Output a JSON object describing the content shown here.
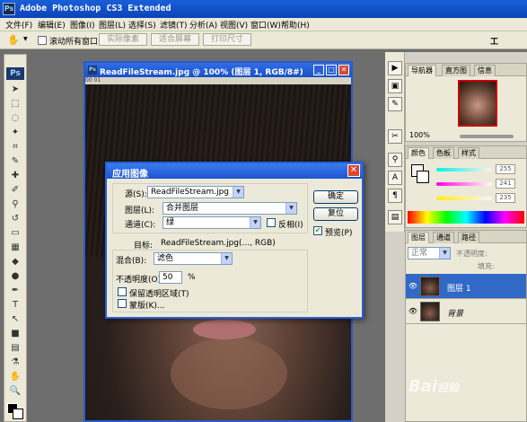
{
  "app": {
    "title": "Adobe Photoshop CS3 Extended",
    "logo": "Ps"
  },
  "menu": [
    "文件(F)",
    "编辑(E)",
    "图像(I)",
    "图层(L)",
    "选择(S)",
    "滤镜(T)",
    "分析(A)",
    "视图(V)",
    "窗口(W)",
    "帮助(H)"
  ],
  "options": {
    "scroll_all_windows": "滚动所有窗口",
    "actual_pixels": "实际像素",
    "fit_screen": "适合屏幕",
    "print_size": "打印尺寸",
    "workspace": "工"
  },
  "document": {
    "title": "ReadFileStream.jpg @ 100% (图层 1, RGB/8#)",
    "ruler_label": "00 01"
  },
  "panels": {
    "navigator_tabs": [
      "导航器",
      "直方图",
      "信息"
    ],
    "zoom": "100%",
    "color_tabs": [
      "颜色",
      "色板",
      "样式"
    ],
    "rgb": {
      "r": "255",
      "g": "241",
      "b": "235"
    },
    "layers_tabs": [
      "图层",
      "通道",
      "路径"
    ],
    "blend_mode": "正常",
    "opacity_label": "不透明度:",
    "fill_label": "填充:",
    "layers": [
      {
        "name": "图层 1",
        "selected": true
      },
      {
        "name": "背景",
        "selected": false
      }
    ]
  },
  "dialog": {
    "title": "应用图像",
    "source_label": "源(S):",
    "source_value": "ReadFileStream.jpg",
    "layer_label": "图层(L):",
    "layer_value": "合并图层",
    "channel_label": "通道(C):",
    "channel_value": "绿",
    "invert_label": "反相(I)",
    "target_label": "目标:",
    "target_value": "ReadFileStream.jpg(..., RGB)",
    "blending_label": "混合(B):",
    "blending_value": "滤色",
    "opacity_label": "不透明度(O):",
    "opacity_value": "50",
    "opacity_unit": "%",
    "preserve_label": "保留透明区域(T)",
    "mask_label": "蒙版(K)...",
    "ok": "确定",
    "reset": "复位",
    "preview_label": "预览(P)"
  },
  "watermark": "Bai 经验"
}
